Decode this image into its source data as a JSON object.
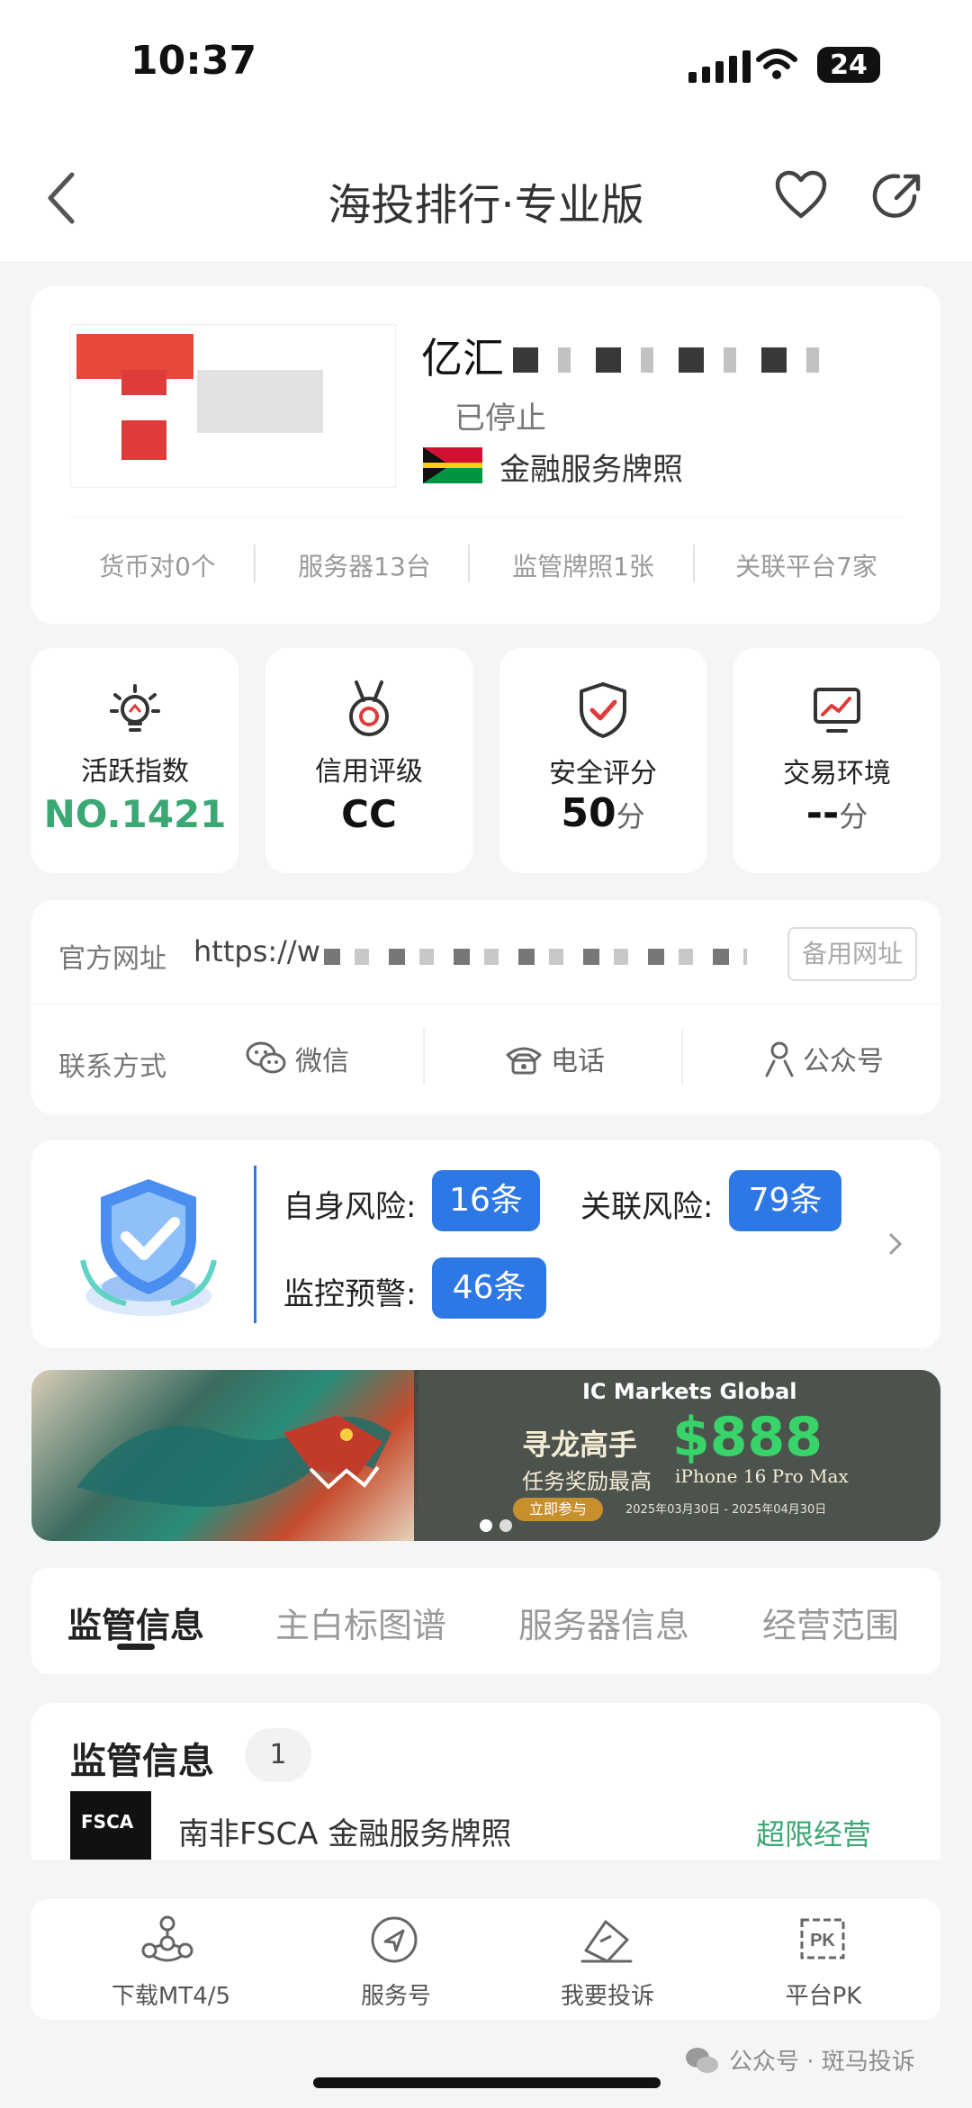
{
  "status": {
    "time": "10:37",
    "battery": "24"
  },
  "header": {
    "title": "海投排行·专业版"
  },
  "broker": {
    "name": "亿汇",
    "status": "已停止",
    "license_type": "金融服务牌照",
    "stats": [
      "货币对0个",
      "服务器13台",
      "监管牌照1张",
      "关联平台7家"
    ]
  },
  "metrics": [
    {
      "label": "活跃指数",
      "value": "NO.1421",
      "unit": ""
    },
    {
      "label": "信用评级",
      "value": "CC",
      "unit": ""
    },
    {
      "label": "安全评分",
      "value": "50",
      "unit": "分"
    },
    {
      "label": "交易环境",
      "value": "--",
      "unit": "分"
    }
  ],
  "contact": {
    "website_label": "官方网址",
    "website_value": "https://w",
    "backup_label": "备用网址",
    "contact_label": "联系方式",
    "wechat": "微信",
    "phone": "电话",
    "official": "公众号"
  },
  "risk": {
    "self_label": "自身风险:",
    "self_value": "16条",
    "related_label": "关联风险:",
    "related_value": "79条",
    "monitor_label": "监控预警:",
    "monitor_value": "46条"
  },
  "banner": {
    "brand": "IC Markets Global",
    "headline": "寻龙高手",
    "amount": "$888",
    "sub": "任务奖励最高",
    "prize": "iPhone 16 Pro Max",
    "dates": "2025年03月30日 - 2025年04月30日",
    "cta": "立即参与"
  },
  "tabs": [
    "监管信息",
    "主白标图谱",
    "服务器信息",
    "经营范围"
  ],
  "regulation": {
    "title": "监管信息",
    "count": "1",
    "item_text": "南非FSCA 金融服务牌照",
    "item_status": "超限经营",
    "logo_text": "FSCA"
  },
  "bottom_nav": [
    "下载MT4/5",
    "服务号",
    "我要投诉",
    "平台PK"
  ],
  "watermark": "公众号 · 斑马投诉",
  "colors": {
    "accent": "#2e78e6",
    "green": "#3aa873",
    "red": "#e03b3b"
  }
}
